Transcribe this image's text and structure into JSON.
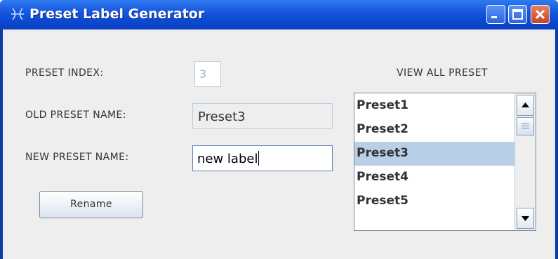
{
  "window": {
    "title": "Preset Label Generator",
    "icons": {
      "app": "preset-generator-icon",
      "minimize": "minimize-icon",
      "maximize": "maximize-icon",
      "close": "close-icon"
    },
    "colors": {
      "titlebar": "#0c49d3",
      "content_bg": "#eeeeee",
      "selection": "#b8cfe5"
    }
  },
  "form": {
    "preset_index_label": "PRESET INDEX:",
    "preset_index_value": "3",
    "old_name_label": "OLD PRESET NAME:",
    "old_name_value": "Preset3",
    "new_name_label": "NEW PRESET NAME:",
    "new_name_value": "new label",
    "rename_button": "Rename"
  },
  "preset_list": {
    "header": "VIEW ALL PRESET",
    "items": [
      "Preset1",
      "Preset2",
      "Preset3",
      "Preset4",
      "Preset5"
    ],
    "selected": "Preset3",
    "icons": {
      "up": "arrow-up-icon",
      "down": "arrow-down-icon",
      "grip": "grip-icon"
    }
  }
}
